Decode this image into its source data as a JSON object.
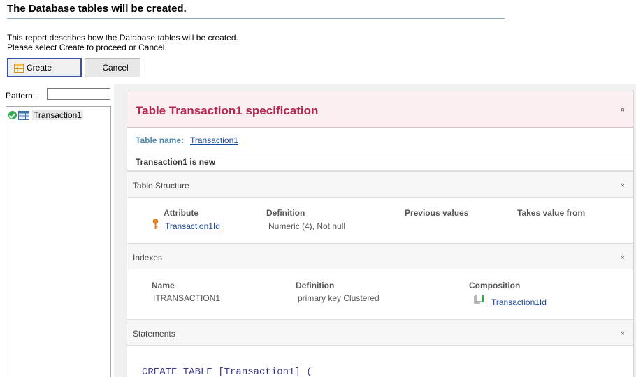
{
  "header": {
    "title": "The Database tables will be created.",
    "desc_line1": "This report describes how the Database tables will be created.",
    "desc_line2": "Please select Create to proceed or Cancel."
  },
  "buttons": {
    "create": "Create",
    "cancel": "Cancel"
  },
  "left_panel": {
    "pattern_label": "Pattern:",
    "pattern_value": "",
    "tree": [
      {
        "label": "Transaction1",
        "status": "ok"
      }
    ]
  },
  "report": {
    "title": "Table Transaction1 specification",
    "table_name_label": "Table name:",
    "table_name_link": "Transaction1",
    "status_text": "Transaction1 is new",
    "collapse_glyph": "»",
    "table_structure": {
      "label": "Table Structure",
      "columns": [
        "Attribute",
        "Definition",
        "Previous values",
        "Takes value from"
      ],
      "rows": [
        {
          "attribute": "Transaction1Id",
          "definition": "Numeric (4), Not null",
          "key_icon": "key-icon"
        }
      ]
    },
    "indexes": {
      "label": "Indexes",
      "columns": [
        "Name",
        "Definition",
        "Composition"
      ],
      "rows": [
        {
          "name": "ITRANSACTION1",
          "definition": "primary key Clustered",
          "composition": "Transaction1Id"
        }
      ]
    },
    "statements": {
      "label": "Statements",
      "sql": "CREATE TABLE [Transaction1] ("
    }
  },
  "colors": {
    "accent": "#b4254f",
    "link": "#1a4b9a",
    "header_bg": "#fbeff2",
    "create_border": "#3a4fa8",
    "ok_green": "#2dab4f"
  }
}
